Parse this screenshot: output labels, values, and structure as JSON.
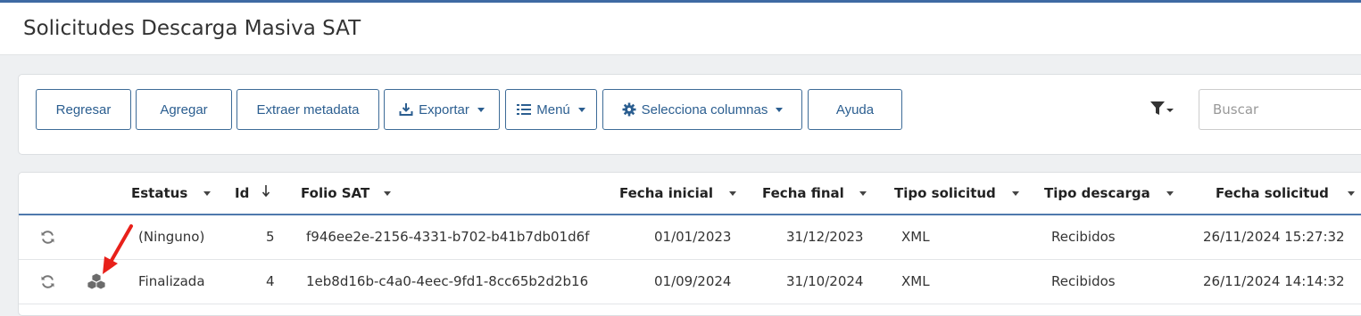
{
  "page": {
    "title": "Solicitudes Descarga Masiva SAT"
  },
  "toolbar": {
    "back_label": "Regresar",
    "add_label": "Agregar",
    "extract_label": "Extraer metadata",
    "export_label": "Exportar",
    "menu_label": "Menú",
    "columns_label": "Selecciona columnas",
    "help_label": "Ayuda",
    "search_placeholder": "Buscar"
  },
  "table": {
    "columns": {
      "status": "Estatus",
      "id": "Id",
      "folio": "Folio SAT",
      "start_date": "Fecha inicial",
      "end_date": "Fecha final",
      "request_type": "Tipo solicitud",
      "download_type": "Tipo descarga",
      "request_date": "Fecha solicitud"
    },
    "rows": [
      {
        "status": "(Ninguno)",
        "id": "5",
        "folio": "f946ee2e-2156-4331-b702-b41b7db01d6f",
        "start_date": "01/01/2023",
        "end_date": "31/12/2023",
        "request_type": "XML",
        "download_type": "Recibidos",
        "request_date": "26/11/2024 15:27:32"
      },
      {
        "status": "Finalizada",
        "id": "4",
        "folio": "1eb8d16b-c4a0-4eec-9fd1-8cc65b2d2b16",
        "start_date": "01/09/2024",
        "end_date": "31/10/2024",
        "request_type": "XML",
        "download_type": "Recibidos",
        "request_date": "26/11/2024 14:14:32"
      }
    ]
  },
  "icons": {
    "refresh": "refresh-icon",
    "download_package": "cubes-icon",
    "annotation": "red-arrow"
  },
  "colors": {
    "accent": "#2b5e90",
    "header_rule": "#4f79ad",
    "annotation": "#e8201a"
  }
}
